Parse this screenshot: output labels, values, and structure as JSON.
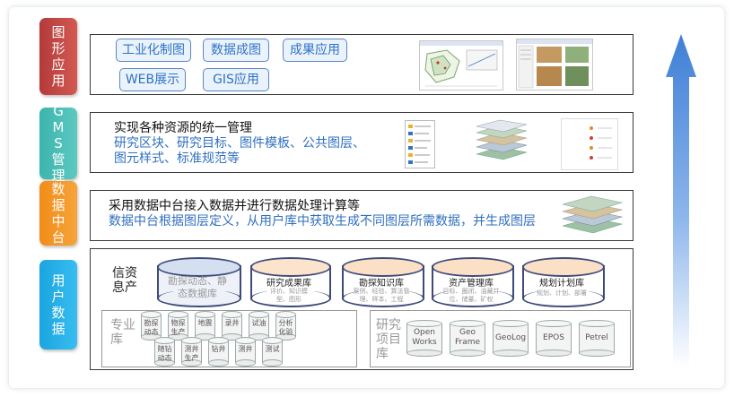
{
  "layers": {
    "graphics": "图形应用",
    "gms": "GMS管理",
    "middle": "数据中台",
    "user": "用户数据"
  },
  "graphics_app": {
    "buttons": [
      "工业化制图",
      "数据成图",
      "成果应用",
      "WEB展示",
      "GIS应用"
    ]
  },
  "gms_box": {
    "line1": "实现各种资源的统一管理",
    "line2": "研究区块、研究目标、图件模板、公共图层、",
    "line3": "图元样式、标准规范等"
  },
  "middle_box": {
    "line1": "采用数据中台接入数据并进行数据处理计算等",
    "line2": "数据中台根据图层定义，从用户库中获取生成不同图层所需数据，并生成图层"
  },
  "user_box": {
    "info_title": "信资息产",
    "databases": [
      {
        "title": "勘探动态、静态数据库",
        "sub": ""
      },
      {
        "title": "研究成果库",
        "sub": "评价、知识模型、图形"
      },
      {
        "title": "勘探知识库",
        "sub": "案例、经验、算法管理、样本、工程"
      },
      {
        "title": "资产管理库",
        "sub": "目标、圈闭、油藏井位、储量、矿权"
      },
      {
        "title": "规划计划库",
        "sub": "规划、计划、部署"
      }
    ],
    "pro_title": "专业库",
    "pro_row1": [
      "勘探动态",
      "物探生产",
      "地震",
      "录井",
      "试油",
      "分析化验"
    ],
    "pro_row2": [
      "随钻动态",
      "测井生产",
      "钻井",
      "测井",
      "测试"
    ],
    "proj_title": "研究项目库",
    "projects": [
      "Open Works",
      "Geo Frame",
      "GeoLog",
      "EPOS",
      "Petrel"
    ]
  },
  "colors": {
    "graphics": "#c0423e",
    "gms": "#46bdb4",
    "middle": "#f39423",
    "user": "#27afe8",
    "arrow": "#4a86d8"
  }
}
